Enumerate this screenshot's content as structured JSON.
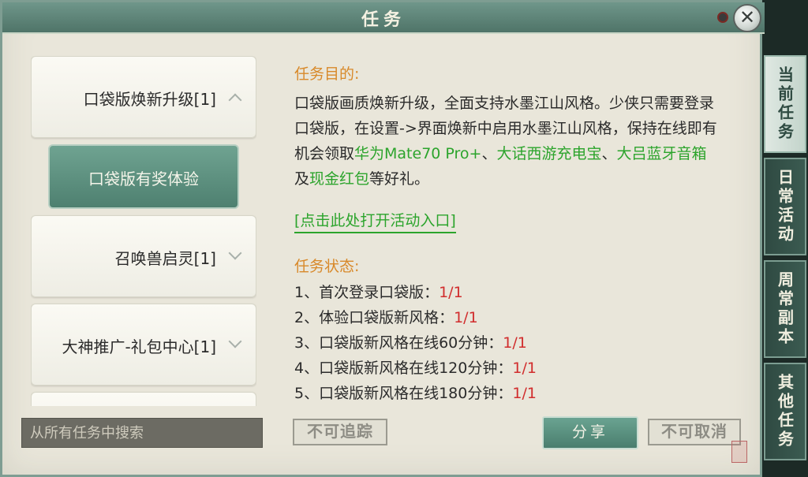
{
  "window": {
    "title": "任务"
  },
  "quest_list": {
    "items": [
      {
        "label": "口袋版焕新升级[1]",
        "expanded": true
      },
      {
        "label": "口袋版有奖体验",
        "selected": true
      },
      {
        "label": "召唤兽启灵[1]",
        "expanded": false
      },
      {
        "label": "大神推广-礼包中心[1]",
        "expanded": false
      }
    ]
  },
  "search": {
    "placeholder": "从所有任务中搜索"
  },
  "detail": {
    "purpose_heading": "任务目的:",
    "purpose_text_1": "口袋版画质焕新升级，全面支持水墨江山风格。少侠只需要登录口袋版，在设置->界面焕新中启用水墨江山风格，保持在线即有机会领取",
    "reward_1": "华为Mate70 Pro+",
    "sep_1": "、",
    "reward_2": "大话西游充电宝",
    "sep_2": "、",
    "reward_3": "大吕蓝牙音箱",
    "sep_3": "及",
    "reward_4": "现金红包",
    "purpose_text_2": "等好礼。",
    "link_text": "[点击此处打开活动入口]",
    "status_heading": "任务状态:",
    "status": [
      {
        "label": "1、首次登录口袋版：",
        "value": "1/1"
      },
      {
        "label": "2、体验口袋版新风格：",
        "value": "1/1"
      },
      {
        "label": "3、口袋版新风格在线60分钟：",
        "value": "1/1"
      },
      {
        "label": "4、口袋版新风格在线120分钟：",
        "value": "1/1"
      },
      {
        "label": "5、口袋版新风格在线180分钟：",
        "value": "1/1"
      }
    ]
  },
  "buttons": {
    "track": "不可追踪",
    "share": "分享",
    "cancel": "不可取消"
  },
  "tabs": [
    {
      "label": "当前任务",
      "active": true
    },
    {
      "label": "日常活动",
      "active": false
    },
    {
      "label": "周常副本",
      "active": false
    },
    {
      "label": "其他任务",
      "active": false
    }
  ],
  "colors": {
    "accent": "#4e8070",
    "heading": "#d8892a",
    "reward": "#2ca42c",
    "progress": "#d12d2d"
  }
}
